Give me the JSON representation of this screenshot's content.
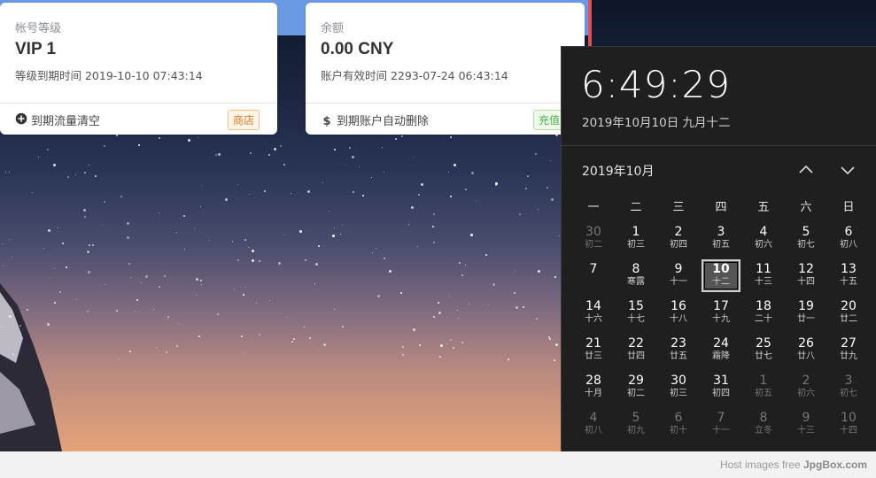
{
  "cards": [
    {
      "title": "帐号等级",
      "value": "VIP 1",
      "sub": "等级到期时间 2019-10-10 07:43:14",
      "footer_icon": "plus-circle-icon",
      "footer_text": "到期流量清空",
      "tag": "商店"
    },
    {
      "title": "余额",
      "value": "0.00 CNY",
      "sub": "账户有效时间 2293-07-24 06:43:14",
      "footer_icon": "dollar-icon",
      "footer_text": "到期账户自动删除",
      "tag": "充值"
    }
  ],
  "clock": {
    "time": "6:49:29",
    "date": "2019年10月10日 九月十二"
  },
  "calendar": {
    "month_label": "2019年10月",
    "weekdays": [
      "一",
      "二",
      "三",
      "四",
      "五",
      "六",
      "日"
    ],
    "days": [
      {
        "n": "30",
        "l": "初二",
        "dim": true
      },
      {
        "n": "1",
        "l": "初三"
      },
      {
        "n": "2",
        "l": "初四"
      },
      {
        "n": "3",
        "l": "初五"
      },
      {
        "n": "4",
        "l": "初六"
      },
      {
        "n": "5",
        "l": "初七"
      },
      {
        "n": "6",
        "l": "初八"
      },
      {
        "n": "7",
        "l": ""
      },
      {
        "n": "8",
        "l": "寒露"
      },
      {
        "n": "9",
        "l": "十一"
      },
      {
        "n": "10",
        "l": "十二",
        "today": true
      },
      {
        "n": "11",
        "l": "十三"
      },
      {
        "n": "12",
        "l": "十四"
      },
      {
        "n": "13",
        "l": "十五"
      },
      {
        "n": "14",
        "l": "十六"
      },
      {
        "n": "15",
        "l": "十七"
      },
      {
        "n": "16",
        "l": "十八"
      },
      {
        "n": "17",
        "l": "十九"
      },
      {
        "n": "18",
        "l": "二十"
      },
      {
        "n": "19",
        "l": "廿一"
      },
      {
        "n": "20",
        "l": "廿二"
      },
      {
        "n": "21",
        "l": "廿三"
      },
      {
        "n": "22",
        "l": "廿四"
      },
      {
        "n": "23",
        "l": "廿五"
      },
      {
        "n": "24",
        "l": "霜降"
      },
      {
        "n": "25",
        "l": "廿七"
      },
      {
        "n": "26",
        "l": "廿八"
      },
      {
        "n": "27",
        "l": "廿九"
      },
      {
        "n": "28",
        "l": "十月"
      },
      {
        "n": "29",
        "l": "初二"
      },
      {
        "n": "30",
        "l": "初三"
      },
      {
        "n": "31",
        "l": "初四"
      },
      {
        "n": "1",
        "l": "初五",
        "dim": true
      },
      {
        "n": "2",
        "l": "初六",
        "dim": true
      },
      {
        "n": "3",
        "l": "初七",
        "dim": true
      },
      {
        "n": "4",
        "l": "初八",
        "dim": true
      },
      {
        "n": "5",
        "l": "初九",
        "dim": true
      },
      {
        "n": "6",
        "l": "初十",
        "dim": true
      },
      {
        "n": "7",
        "l": "十一",
        "dim": true
      },
      {
        "n": "8",
        "l": "立冬",
        "dim": true
      },
      {
        "n": "9",
        "l": "十三",
        "dim": true
      },
      {
        "n": "10",
        "l": "十四",
        "dim": true
      }
    ]
  },
  "watermark": {
    "prefix": "Host images free ",
    "brand": "JpgBox.com"
  },
  "colors": {
    "flyout_bg": "#1f1f1f",
    "shop_tag": "#e07a2a",
    "recharge_tag": "#4caf50",
    "top_strip": "#6a9ae6"
  }
}
